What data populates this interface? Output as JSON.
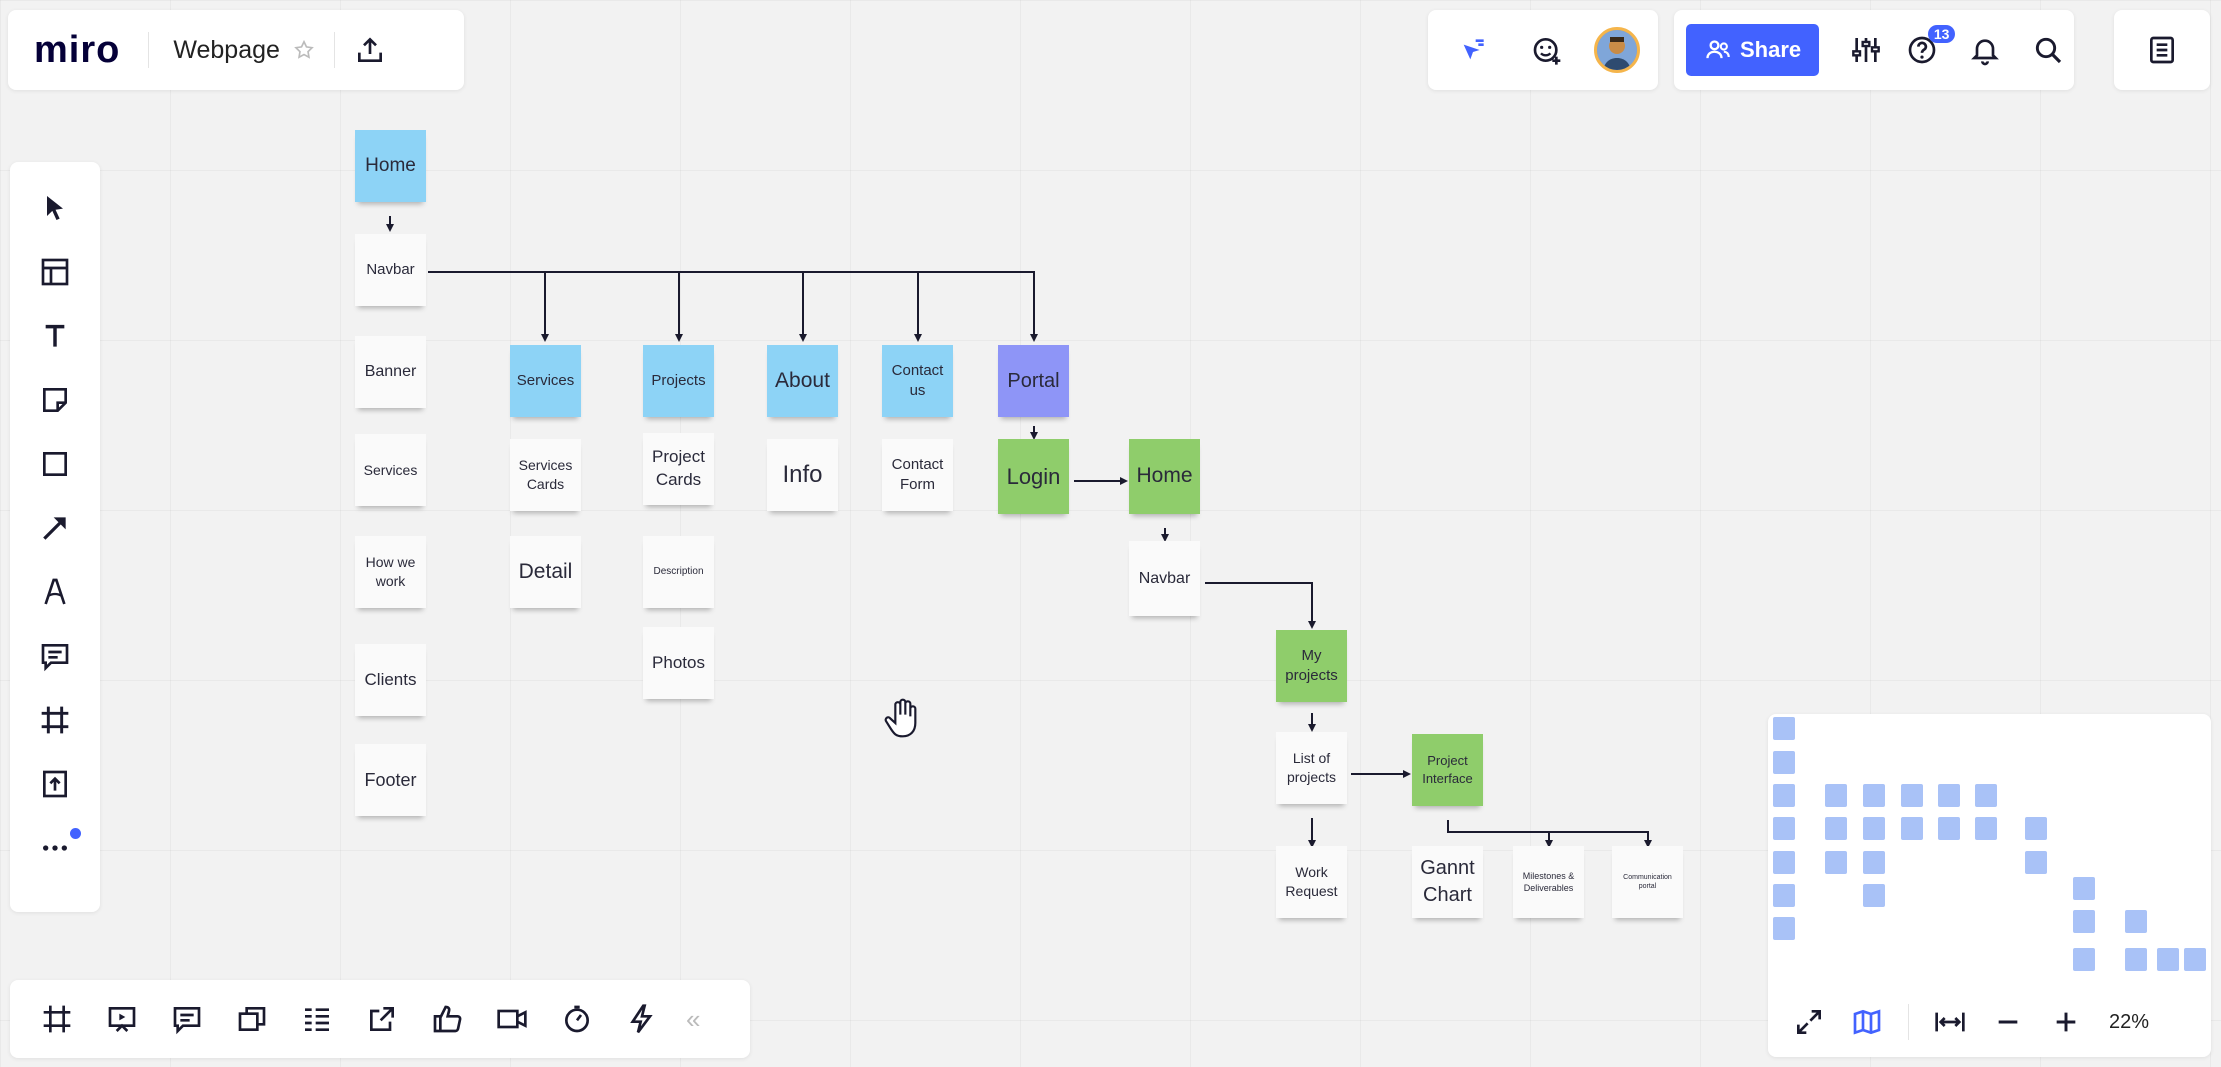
{
  "app": {
    "logo": "miro",
    "board_title": "Webpage",
    "notification_count": "13",
    "share_label": "Share",
    "zoom": "22%",
    "collapse_glyph": "«"
  },
  "board": {
    "notes": [
      {
        "id": "home-1",
        "label": "Home",
        "color": "blue"
      },
      {
        "id": "navbar-1",
        "label": "Navbar",
        "color": "white"
      },
      {
        "id": "banner",
        "label": "Banner",
        "color": "white"
      },
      {
        "id": "services-section",
        "label": "Services",
        "color": "white"
      },
      {
        "id": "how-we-work",
        "label": "How we work",
        "color": "white"
      },
      {
        "id": "clients",
        "label": "Clients",
        "color": "white"
      },
      {
        "id": "footer",
        "label": "Footer",
        "color": "white"
      },
      {
        "id": "services",
        "label": "Services",
        "color": "blue"
      },
      {
        "id": "services-cards",
        "label": "Services Cards",
        "color": "white"
      },
      {
        "id": "detail",
        "label": "Detail",
        "color": "white"
      },
      {
        "id": "projects",
        "label": "Projects",
        "color": "blue"
      },
      {
        "id": "project-cards",
        "label": "Project Cards",
        "color": "white"
      },
      {
        "id": "description",
        "label": "Description",
        "color": "white"
      },
      {
        "id": "photos",
        "label": "Photos",
        "color": "white"
      },
      {
        "id": "about",
        "label": "About",
        "color": "blue"
      },
      {
        "id": "info",
        "label": "Info",
        "color": "white"
      },
      {
        "id": "contact-us",
        "label": "Contact us",
        "color": "blue"
      },
      {
        "id": "contact-form",
        "label": "Contact Form",
        "color": "white"
      },
      {
        "id": "portal",
        "label": "Portal",
        "color": "violet"
      },
      {
        "id": "login",
        "label": "Login",
        "color": "green"
      },
      {
        "id": "home-2",
        "label": "Home",
        "color": "green"
      },
      {
        "id": "navbar-2",
        "label": "Navbar",
        "color": "white"
      },
      {
        "id": "my-projects",
        "label": "My projects",
        "color": "green"
      },
      {
        "id": "list-of-projects",
        "label": "List of projects",
        "color": "white"
      },
      {
        "id": "project-interface",
        "label": "Project Interface",
        "color": "green"
      },
      {
        "id": "work-request",
        "label": "Work Request",
        "color": "white"
      },
      {
        "id": "gannt-chart",
        "label": "Gannt Chart",
        "color": "white"
      },
      {
        "id": "milestones",
        "label": "Milestones & Deliverables",
        "color": "white"
      },
      {
        "id": "communication-portal",
        "label": "Communication portal",
        "color": "white"
      }
    ]
  },
  "colors": {
    "accent": "#4262ff",
    "canvas": "#f2f2f2",
    "note_blue": "#8dd3f6",
    "note_green": "#8fcd6b",
    "note_violet": "#8e95f7",
    "minimap_note": "#a9c2f7",
    "badge": "#4262ff"
  },
  "icons": {
    "top_left": [
      "star-icon",
      "upload-icon"
    ],
    "top_right": [
      "cursor-signal-icon",
      "reaction-add-icon",
      "avatar",
      "share-users-icon",
      "settings-sliders-icon",
      "help-icon",
      "bell-icon",
      "search-icon",
      "notes-panel-icon"
    ],
    "left_toolbar": [
      "select-pointer-icon",
      "templates-icon",
      "text-icon",
      "sticky-note-icon",
      "shape-icon",
      "connection-line-icon",
      "pen-icon",
      "comment-icon",
      "frame-icon",
      "upload-file-icon",
      "more-tools-icon"
    ],
    "bottom_toolbar": [
      "frames-icon",
      "presentation-icon",
      "comments-panel-icon",
      "cards-icon",
      "kanban-icon",
      "share-export-icon",
      "voting-icon",
      "video-call-icon",
      "timer-icon",
      "lightning-icon",
      "collapse-icon"
    ],
    "minimap": [
      "fullscreen-icon",
      "map-icon",
      "fit-width-icon",
      "zoom-out-icon",
      "zoom-in-icon"
    ],
    "canvas": [
      "hand-cursor-icon"
    ]
  }
}
